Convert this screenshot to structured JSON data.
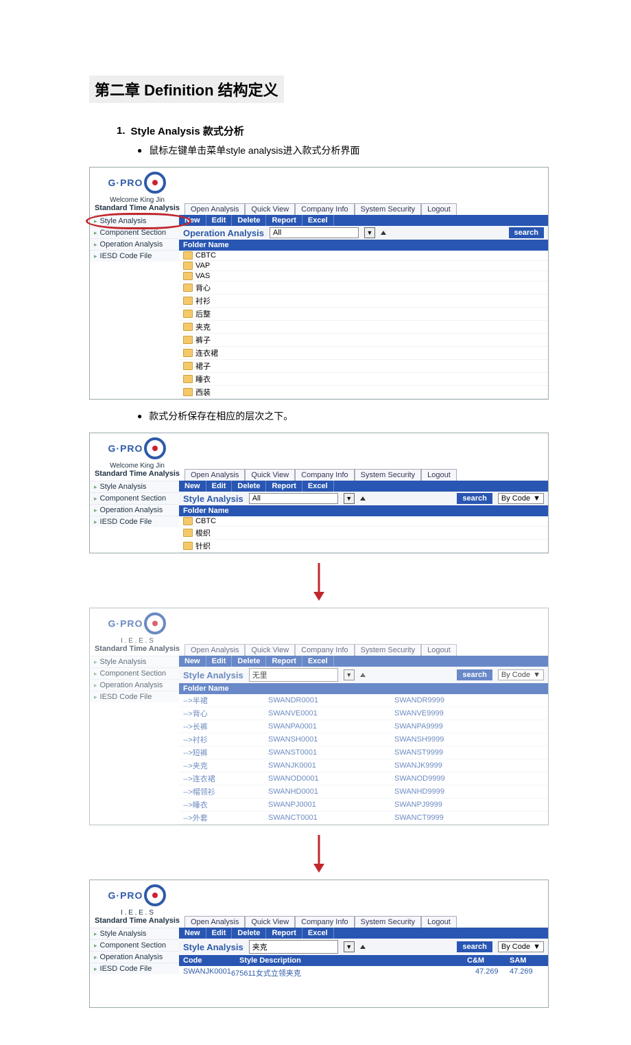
{
  "chapter": {
    "pre": "第二章 ",
    "en": "Definition",
    "post": " 结构定义"
  },
  "section1": {
    "num": "1.",
    "title_en": "Style Analysis",
    "title_zh": " 款式分析"
  },
  "b1": "鼠标左键单击菜单style analysis进入款式分析界面",
  "b2": "款式分析保存在相应的层次之下。",
  "common": {
    "logo": "G·PRO",
    "tabs": [
      "Open Analysis",
      "Quick View",
      "Company Info",
      "System Security",
      "Logout"
    ],
    "btns": [
      "New",
      "Edit",
      "Delete",
      "Report",
      "Excel"
    ],
    "nav": [
      "Style Analysis",
      "Component Section",
      "Operation Analysis",
      "IESD Code File"
    ],
    "search": "search",
    "bycode": "By Code",
    "folderhdr": "Folder Name"
  },
  "shot1": {
    "welcome": "Welcome King Jin",
    "subtitle": "Standard Time Analysis",
    "headtitle": "Operation Analysis",
    "filter": "All",
    "folders": [
      "CBTC",
      "VAP",
      "VAS",
      "背心",
      "衬衫",
      "后整",
      "夹克",
      "裤子",
      "连衣裙",
      "裙子",
      "睡衣",
      "西装"
    ]
  },
  "shot2": {
    "welcome": "Welcome King Jin",
    "subtitle": "Standard Time Analysis",
    "headtitle": "Style Analysis",
    "filter": "All",
    "folders": [
      "CBTC",
      "梭织",
      "针织"
    ]
  },
  "shot3": {
    "welcome": "I . E . E . S",
    "subtitle": "Standard Time Analysis",
    "headtitle": "Style Analysis",
    "filter": "无里",
    "rows": [
      {
        "n": "-->半裙",
        "a": "SWANDR0001",
        "b": "SWANDR9999"
      },
      {
        "n": "-->背心",
        "a": "SWANVE0001",
        "b": "SWANVE9999"
      },
      {
        "n": "-->长裤",
        "a": "SWANPA0001",
        "b": "SWANPA9999"
      },
      {
        "n": "-->衬衫",
        "a": "SWANSH0001",
        "b": "SWANSH9999"
      },
      {
        "n": "-->短裤",
        "a": "SWANST0001",
        "b": "SWANST9999"
      },
      {
        "n": "-->夹克",
        "a": "SWANJK0001",
        "b": "SWANJK9999"
      },
      {
        "n": "-->连衣裙",
        "a": "SWANOD0001",
        "b": "SWANOD9999"
      },
      {
        "n": "-->帽领衫",
        "a": "SWANHD0001",
        "b": "SWANHD9999"
      },
      {
        "n": "-->睡衣",
        "a": "SWANPJ0001",
        "b": "SWANPJ9999"
      },
      {
        "n": "-->外套",
        "a": "SWANCT0001",
        "b": "SWANCT9999"
      }
    ]
  },
  "shot4": {
    "welcome": "I . E . E . S",
    "subtitle": "Standard Time Analysis",
    "headtitle": "Style Analysis",
    "filter": "夹克",
    "hdr": {
      "code": "Code",
      "desc": "Style Description",
      "cm": "C&M",
      "sam": "SAM"
    },
    "row": {
      "code": "SWANJK0001",
      "desc": "675611女式立领夹克",
      "cm": "47.269",
      "sam": "47.269"
    }
  }
}
